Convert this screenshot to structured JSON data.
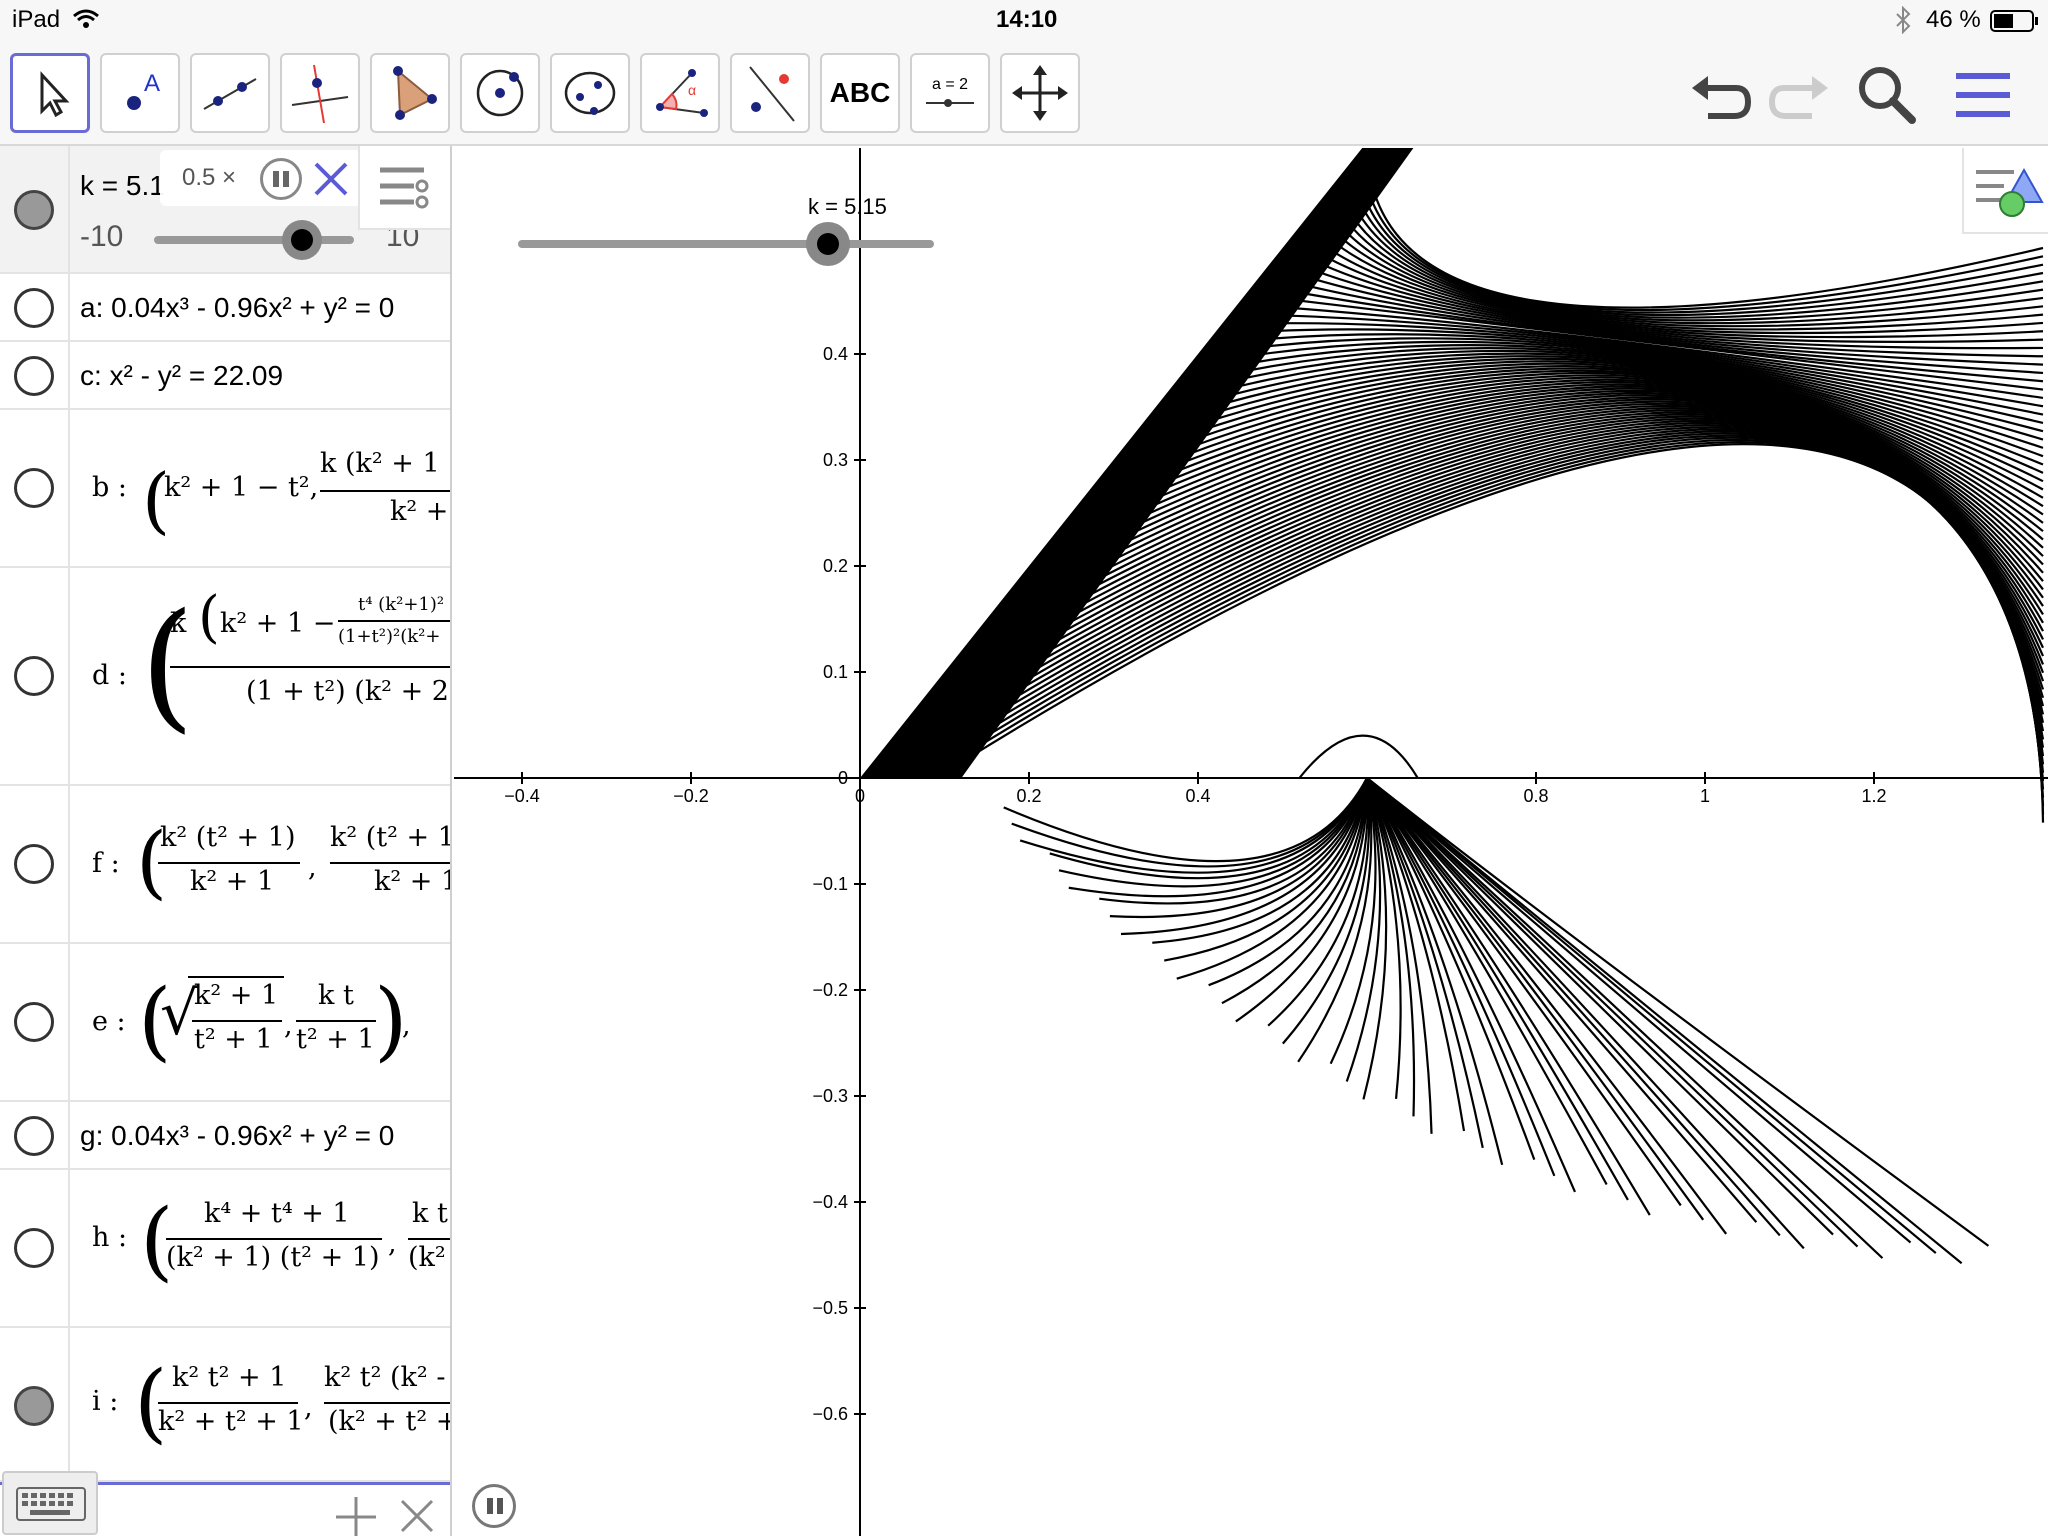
{
  "status": {
    "device": "iPad",
    "time": "14:10",
    "battery": "46 %"
  },
  "toolbar": {
    "tools": [
      {
        "name": "move-tool",
        "icon": "arrow-cursor-icon"
      },
      {
        "name": "point-tool",
        "icon": "point-icon",
        "label": "A"
      },
      {
        "name": "line-tool",
        "icon": "line-icon"
      },
      {
        "name": "perpendicular-tool",
        "icon": "perpendicular-line-icon"
      },
      {
        "name": "polygon-tool",
        "icon": "polygon-icon"
      },
      {
        "name": "circle-tool",
        "icon": "circle-icon"
      },
      {
        "name": "conic-tool",
        "icon": "conic-icon"
      },
      {
        "name": "angle-tool",
        "icon": "angle-icon",
        "label": "α"
      },
      {
        "name": "reflect-tool",
        "icon": "reflect-icon"
      },
      {
        "name": "text-tool",
        "icon": "text-icon",
        "label": "ABC"
      },
      {
        "name": "slider-tool",
        "icon": "slider-icon",
        "label": "a = 2"
      },
      {
        "name": "move-graphics-tool",
        "icon": "move-cross-icon"
      }
    ],
    "right": [
      "undo-icon",
      "redo-icon",
      "search-icon",
      "menu-icon"
    ]
  },
  "algebra": {
    "slider": {
      "label": "k = 5.1",
      "min": "-10",
      "max": "10",
      "speed": "0.5 ×",
      "value": 5.15
    },
    "rows": [
      {
        "name": "a",
        "text": "a: 0.04x³ - 0.96x² + y² = 0"
      },
      {
        "name": "c",
        "text": "c: x² - y² = 22.09"
      },
      {
        "name": "b",
        "label": "b :"
      },
      {
        "name": "d",
        "label": "d :"
      },
      {
        "name": "f",
        "label": "f :"
      },
      {
        "name": "e",
        "label": "e :"
      },
      {
        "name": "g",
        "text": "g: 0.04x³ - 0.96x² + y² = 0"
      },
      {
        "name": "h",
        "label": "h :"
      },
      {
        "name": "i",
        "label": "i :"
      }
    ],
    "math": {
      "b": {
        "a": "k² + 1 − t²,",
        "b_num": "k  (k² + 1",
        "b_den": "k² +"
      },
      "d": {
        "k": "k",
        "inner": "k² + 1 −",
        "small_num": "t⁴ (k²+1)²",
        "small_den": "(1+t²)²(k²+",
        "den": "(1 + t²)  (k² + 2"
      },
      "f": {
        "num1": "k²  (t² + 1)",
        "den1": "k² + 1",
        "num2": "k²  (t² + 1",
        "den2": "k² + 1"
      },
      "e": {
        "sq_num": "k² + 1",
        "sq_den": "t² + 1",
        "num2": "k t",
        "den2": "t² + 1"
      },
      "h": {
        "num1": "k⁴ + t⁴ + 1",
        "den1": "(k² + 1)  (t² + 1)",
        "num2": "k t",
        "den2": "(k²"
      },
      "i": {
        "num1": "k² t² + 1",
        "den1": "k² + t² + 1",
        "num2": "k² t²  (k² -",
        "den2": "(k² + t² +"
      }
    }
  },
  "graphics": {
    "slider_label": "k = 5.15",
    "x_ticks": [
      "−0.4",
      "−0.2",
      "0",
      "0.2",
      "0.4",
      "0.8",
      "1",
      "1.2"
    ],
    "y_ticks": [
      "0.4",
      "0.3",
      "0.2",
      "0.1",
      "0",
      "−0.1",
      "−0.2",
      "−0.3",
      "−0.4",
      "−0.5",
      "−0.6"
    ]
  }
}
